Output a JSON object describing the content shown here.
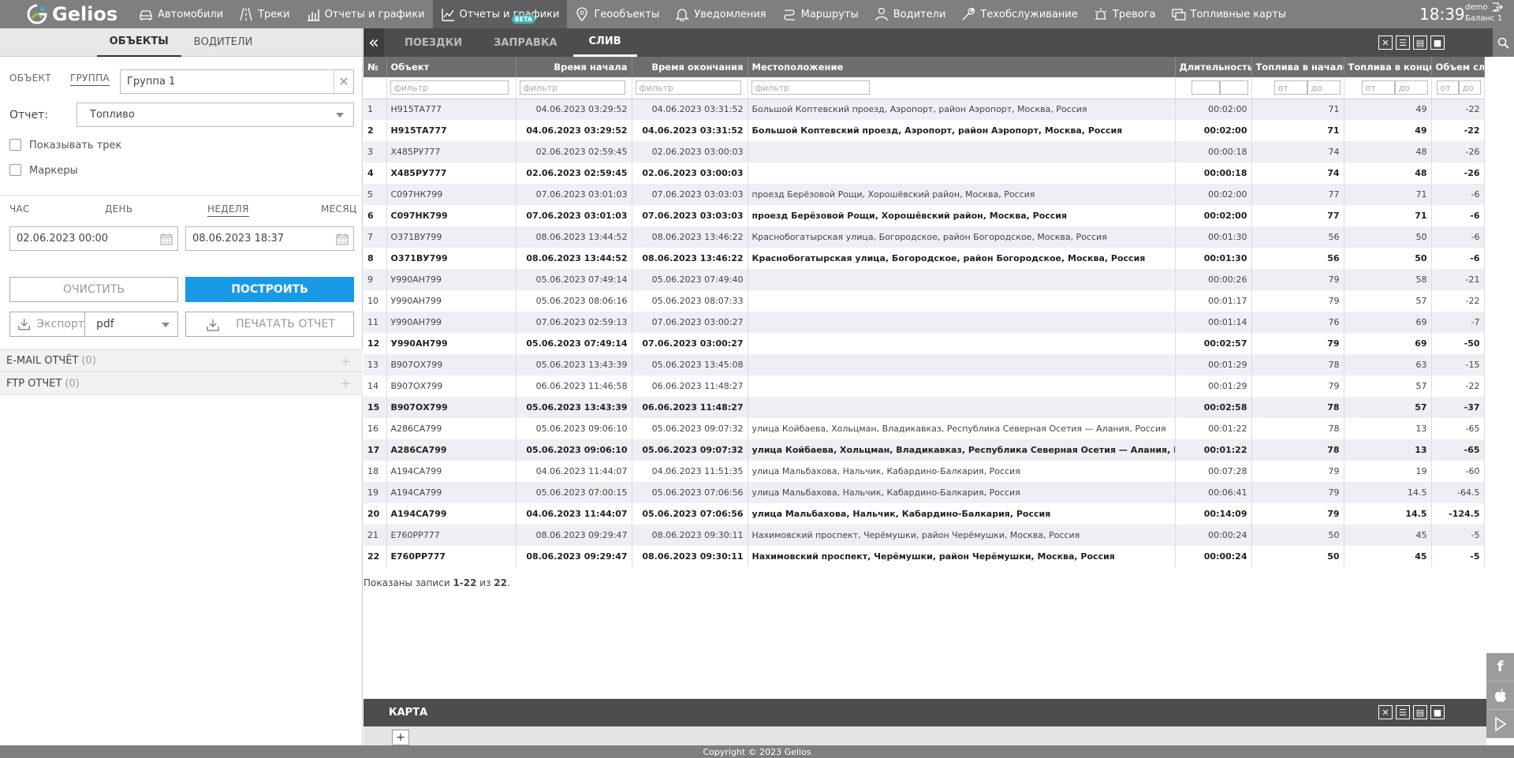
{
  "brand": {
    "name": "Gelios"
  },
  "nav": [
    {
      "label": "Автомобили",
      "icon": "car-icon"
    },
    {
      "label": "Треки",
      "icon": "road-icon"
    },
    {
      "label": "Отчеты и графики",
      "icon": "bar-chart-icon"
    },
    {
      "label": "Отчеты и графики",
      "icon": "line-chart-icon",
      "badge": "BETA",
      "active": true
    },
    {
      "label": "Геообъекты",
      "icon": "map-pin-icon"
    },
    {
      "label": "Уведомления",
      "icon": "bell-icon"
    },
    {
      "label": "Маршруты",
      "icon": "route-icon"
    },
    {
      "label": "Водители",
      "icon": "user-icon"
    },
    {
      "label": "Техобслуживание",
      "icon": "wrench-icon"
    },
    {
      "label": "Тревога",
      "icon": "alarm-icon"
    },
    {
      "label": "Топливные карты",
      "icon": "cards-icon"
    }
  ],
  "header": {
    "time": "18:39",
    "user": "demo",
    "balance": "Баланс 1"
  },
  "left": {
    "tabs": [
      "ОБЪЕКТЫ",
      "ВОДИТЕЛИ"
    ],
    "mode_object": "ОБЪЕКТ",
    "mode_group": "ГРУППА",
    "group_value": "Группа 1",
    "report_label": "Отчет:",
    "report_value": "Топливо",
    "show_track": "Показывать трек",
    "markers": "Маркеры",
    "periods": [
      "ЧАС",
      "ДЕНЬ",
      "НЕДЕЛЯ",
      "МЕСЯЦ"
    ],
    "date_from": "02.06.2023 00:00",
    "date_to": "08.06.2023 18:37",
    "clear_btn": "ОЧИСТИТЬ",
    "build_btn": "ПОСТРОИТЬ",
    "export_btn": "Экспорт",
    "format_value": "pdf",
    "print_btn": "ПЕЧАТАТЬ ОТЧЕТ",
    "email_section": "E-MAIL ОТЧЁТ",
    "email_count": "(0)",
    "ftp_section": "FTP ОТЧЕТ",
    "ftp_count": "(0)"
  },
  "report": {
    "tabs": [
      "ПОЕЗДКИ",
      "ЗАПРАВКА",
      "СЛИВ"
    ],
    "active_tab": "СЛИВ",
    "columns": [
      "№",
      "Объект",
      "Время начала",
      "Время окончания",
      "Местоположение",
      "Длительность",
      "Топлива в начале",
      "Топлива в конце",
      "Объем слива"
    ],
    "filter_placeholder": "фильтр",
    "from_placeholder": "от",
    "to_placeholder": "до",
    "rows": [
      [
        "1",
        "Н915ТА777",
        "04.06.2023 03:29:52",
        "04.06.2023 03:31:52",
        "Большой Коптевский проезд, Аэропорт, район Аэропорт, Москва, Россия",
        "00:02:00",
        "71",
        "49",
        "-22",
        false
      ],
      [
        "2",
        "Н915ТА777",
        "04.06.2023 03:29:52",
        "04.06.2023 03:31:52",
        "Большой Коптевский проезд, Аэропорт, район Аэропорт, Москва, Россия",
        "00:02:00",
        "71",
        "49",
        "-22",
        true
      ],
      [
        "3",
        "Х485РУ777",
        "02.06.2023 02:59:45",
        "02.06.2023 03:00:03",
        "",
        "00:00:18",
        "74",
        "48",
        "-26",
        false
      ],
      [
        "4",
        "Х485РУ777",
        "02.06.2023 02:59:45",
        "02.06.2023 03:00:03",
        "",
        "00:00:18",
        "74",
        "48",
        "-26",
        true
      ],
      [
        "5",
        "С097НК799",
        "07.06.2023 03:01:03",
        "07.06.2023 03:03:03",
        "проезд Берёзовой Рощи, Хорошёвский район, Москва, Россия",
        "00:02:00",
        "77",
        "71",
        "-6",
        false
      ],
      [
        "6",
        "С097НК799",
        "07.06.2023 03:01:03",
        "07.06.2023 03:03:03",
        "проезд Берёзовой Рощи, Хорошёвский район, Москва, Россия",
        "00:02:00",
        "77",
        "71",
        "-6",
        true
      ],
      [
        "7",
        "О371ВУ799",
        "08.06.2023 13:44:52",
        "08.06.2023 13:46:22",
        "Краснобогатырская улица, Богородское, район Богородское, Москва, Россия",
        "00:01:30",
        "56",
        "50",
        "-6",
        false
      ],
      [
        "8",
        "О371ВУ799",
        "08.06.2023 13:44:52",
        "08.06.2023 13:46:22",
        "Краснобогатырская улица, Богородское, район Богородское, Москва, Россия",
        "00:01:30",
        "56",
        "50",
        "-6",
        true
      ],
      [
        "9",
        "У990АН799",
        "05.06.2023 07:49:14",
        "05.06.2023 07:49:40",
        "",
        "00:00:26",
        "79",
        "58",
        "-21",
        false
      ],
      [
        "10",
        "У990АН799",
        "05.06.2023 08:06:16",
        "05.06.2023 08:07:33",
        "",
        "00:01:17",
        "79",
        "57",
        "-22",
        false
      ],
      [
        "11",
        "У990АН799",
        "07.06.2023 02:59:13",
        "07.06.2023 03:00:27",
        "",
        "00:01:14",
        "76",
        "69",
        "-7",
        false
      ],
      [
        "12",
        "У990АН799",
        "05.06.2023 07:49:14",
        "07.06.2023 03:00:27",
        "",
        "00:02:57",
        "79",
        "69",
        "-50",
        true
      ],
      [
        "13",
        "В907ОХ799",
        "05.06.2023 13:43:39",
        "05.06.2023 13:45:08",
        "",
        "00:01:29",
        "78",
        "63",
        "-15",
        false
      ],
      [
        "14",
        "В907ОХ799",
        "06.06.2023 11:46:58",
        "06.06.2023 11:48:27",
        "",
        "00:01:29",
        "79",
        "57",
        "-22",
        false
      ],
      [
        "15",
        "В907ОХ799",
        "05.06.2023 13:43:39",
        "06.06.2023 11:48:27",
        "",
        "00:02:58",
        "78",
        "57",
        "-37",
        true
      ],
      [
        "16",
        "А286СА799",
        "05.06.2023 09:06:10",
        "05.06.2023 09:07:32",
        "улица Койбаева, Хольцман, Владикавказ, Республика Северная Осетия — Алания, Россия",
        "00:01:22",
        "78",
        "13",
        "-65",
        false
      ],
      [
        "17",
        "А286СА799",
        "05.06.2023 09:06:10",
        "05.06.2023 09:07:32",
        "улица Койбаева, Хольцман, Владикавказ, Республика Северная Осетия — Алания, Россия",
        "00:01:22",
        "78",
        "13",
        "-65",
        true
      ],
      [
        "18",
        "А194СА799",
        "04.06.2023 11:44:07",
        "04.06.2023 11:51:35",
        "улица Мальбахова, Нальчик, Кабардино-Балкария, Россия",
        "00:07:28",
        "79",
        "19",
        "-60",
        false
      ],
      [
        "19",
        "А194СА799",
        "05.06.2023 07:00:15",
        "05.06.2023 07:06:56",
        "улица Мальбахова, Нальчик, Кабардино-Балкария, Россия",
        "00:06:41",
        "79",
        "14.5",
        "-64.5",
        false
      ],
      [
        "20",
        "А194СА799",
        "04.06.2023 11:44:07",
        "05.06.2023 07:06:56",
        "улица Мальбахова, Нальчик, Кабардино-Балкария, Россия",
        "00:14:09",
        "79",
        "14.5",
        "-124.5",
        true
      ],
      [
        "21",
        "Е760РР777",
        "08.06.2023 09:29:47",
        "08.06.2023 09:30:11",
        "Нахимовский проспект, Черёмушки, район Черёмушки, Москва, Россия",
        "00:00:24",
        "50",
        "45",
        "-5",
        false
      ],
      [
        "22",
        "Е760РР777",
        "08.06.2023 09:29:47",
        "08.06.2023 09:30:11",
        "Нахимовский проспект, Черёмушки, район Черёмушки, Москва, Россия",
        "00:00:24",
        "50",
        "45",
        "-5",
        true
      ]
    ],
    "summary_prefix": "Показаны записи ",
    "summary_range": "1-22",
    "summary_mid": " из ",
    "summary_total": "22",
    "summary_suffix": "."
  },
  "map": {
    "title": "КАРТА",
    "zoom_in": "+"
  },
  "footer": {
    "copyright": "Copyright © 2023 Gelios"
  },
  "colors": {
    "accent": "#1a9ae6",
    "topbar": "#7f7f7f",
    "dark": "#4d4d4d",
    "beta": "#3bb4b4"
  }
}
